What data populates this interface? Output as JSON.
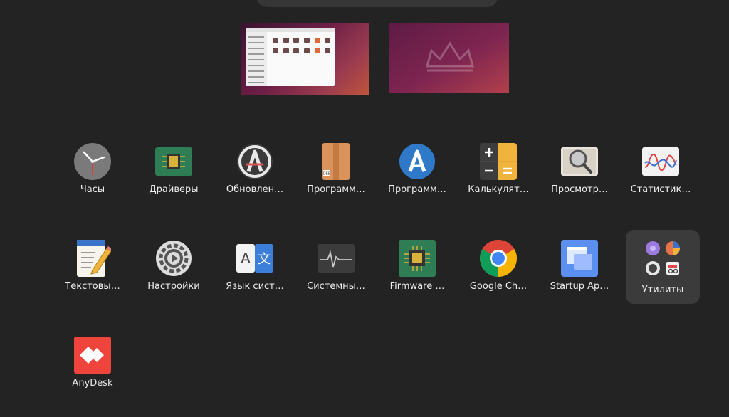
{
  "overview": {
    "workspaces": [
      {
        "name": "workspace-1"
      },
      {
        "name": "workspace-2"
      }
    ]
  },
  "apps": [
    {
      "label": "Часы",
      "icon": "clock-icon"
    },
    {
      "label": "Драйверы",
      "icon": "chip-icon"
    },
    {
      "label": "Обновлен…",
      "icon": "software-updater-icon"
    },
    {
      "label": "Программ…",
      "icon": "package-installer-icon"
    },
    {
      "label": "Программ…",
      "icon": "app-center-icon"
    },
    {
      "label": "Калькулят…",
      "icon": "calculator-icon"
    },
    {
      "label": "Просмотр…",
      "icon": "image-viewer-icon"
    },
    {
      "label": "Статистик…",
      "icon": "statistics-icon"
    },
    {
      "label": "Текстовы…",
      "icon": "text-editor-icon"
    },
    {
      "label": "Настройки",
      "icon": "settings-gear-icon"
    },
    {
      "label": "Язык сист…",
      "icon": "language-icon"
    },
    {
      "label": "Системны…",
      "icon": "system-monitor-icon"
    },
    {
      "label": "Firmware …",
      "icon": "firmware-chip-icon"
    },
    {
      "label": "Google Ch…",
      "icon": "chrome-icon"
    },
    {
      "label": "Startup Ap…",
      "icon": "startup-apps-icon"
    },
    {
      "label": "Утилиты",
      "icon": "folder-icon"
    },
    {
      "label": "AnyDesk",
      "icon": "anydesk-icon"
    }
  ]
}
